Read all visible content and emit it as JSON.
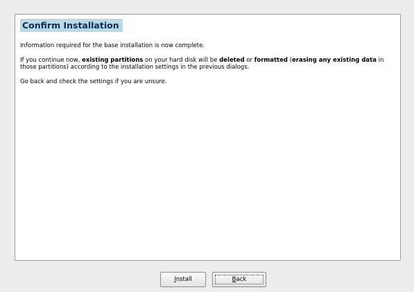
{
  "dialog": {
    "title": "Confirm Installation",
    "paragraph1": "Information required for the base installation is now complete.",
    "paragraph2": {
      "t1": "If you continue now, ",
      "b1": "existing partitions",
      "t2": " on your hard disk will be ",
      "b2": "deleted",
      "t3": " or ",
      "b3": "formatted",
      "t4": " (",
      "b4": "erasing any existing data",
      "t5": " in those partitions) according to the installation settings in the previous dialogs."
    },
    "paragraph3": "Go back and check the settings if you are unsure."
  },
  "buttons": {
    "install": {
      "mnemonic": "I",
      "rest": "nstall"
    },
    "back": {
      "mnemonic": "B",
      "rest": "ack"
    }
  }
}
